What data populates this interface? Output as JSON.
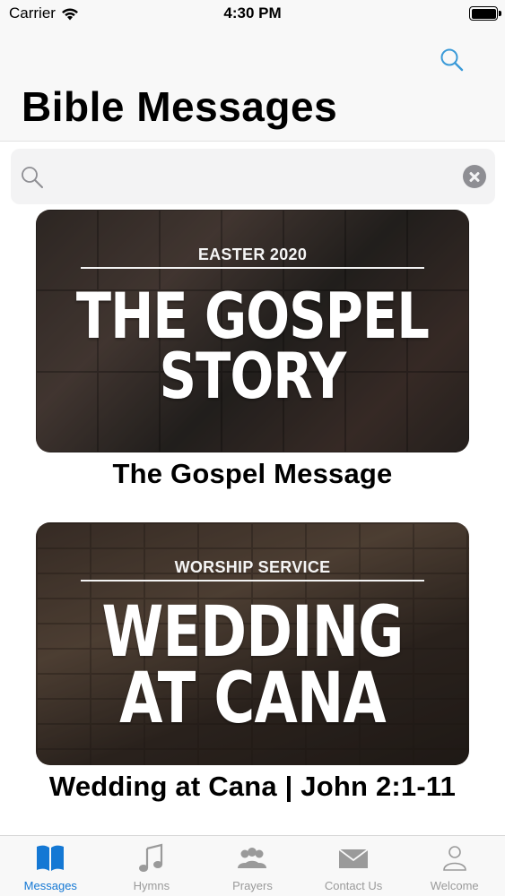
{
  "status_bar": {
    "carrier": "Carrier",
    "time": "4:30 PM"
  },
  "nav": {
    "title": "Bible Messages",
    "search_icon": "magnifier-icon"
  },
  "search": {
    "value": "",
    "placeholder": "",
    "clear_icon": "clear-circle-icon"
  },
  "messages": [
    {
      "thumbnail_kicker": "EASTER 2020",
      "thumbnail_headline": "THE GOSPEL\nSTORY",
      "title": "The Gospel Message"
    },
    {
      "thumbnail_kicker": "WORSHIP SERVICE",
      "thumbnail_headline": "WEDDING\nAT CANA",
      "title": "Wedding at Cana | John 2:1-11"
    }
  ],
  "tabs": [
    {
      "label": "Messages",
      "icon": "book-icon",
      "active": true
    },
    {
      "label": "Hymns",
      "icon": "music-note-icon",
      "active": false
    },
    {
      "label": "Prayers",
      "icon": "people-icon",
      "active": false
    },
    {
      "label": "Contact Us",
      "icon": "envelope-icon",
      "active": false
    },
    {
      "label": "Welcome",
      "icon": "person-icon",
      "active": false
    }
  ],
  "colors": {
    "accent": "#1478d4",
    "tab_inactive": "#9a9a9a",
    "search_icon": "#3a9ad8"
  }
}
